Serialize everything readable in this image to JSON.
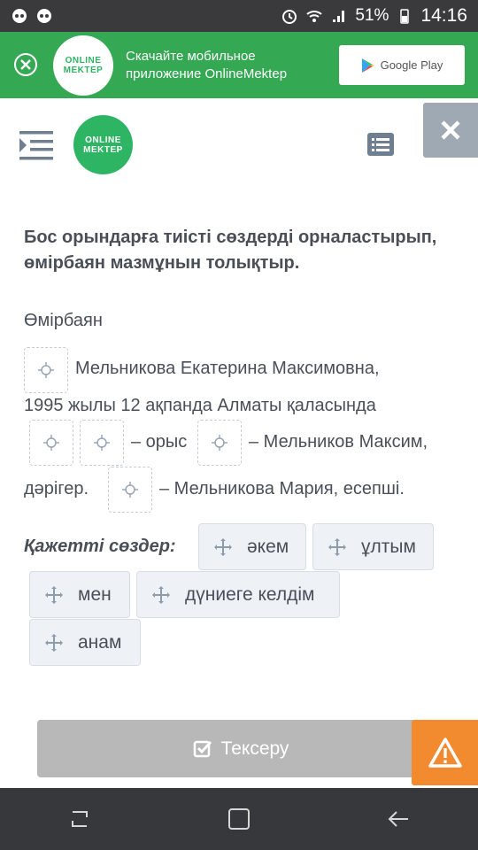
{
  "status_bar": {
    "battery": "51%",
    "time": "14:16"
  },
  "banner": {
    "logo_text_line1": "ONLINE",
    "logo_text_line2": "MEKTEP",
    "line1": "Скачайте мобильное",
    "line2": "приложение OnlineMektep",
    "store_button": "Google Play"
  },
  "header": {
    "logo_line1": "ONLINE",
    "logo_line2": "MEKTEP"
  },
  "task": {
    "question": "Бос орындарға тиісті сөздерді орналастырып, өмірбаян мазмұнын толықтыр.",
    "subtitle": "Өмірбаян",
    "text_1": "Мельникова Екатерина Максимовна,",
    "text_2": "1995 жылы 12 ақпанда Алматы қаласында",
    "text_3": "– орыс",
    "text_4": "– Мельников Максим,",
    "text_5": "дәрігер.",
    "text_6": "– Мельникова Мария, есепші."
  },
  "words": {
    "label": "Қажетті сөздер:",
    "items": [
      "әкем",
      "ұлтым",
      "мен",
      "дүниеге келдім",
      "анам"
    ]
  },
  "footer": {
    "check_button": "Тексеру"
  },
  "colors": {
    "brand_green": "#34a853",
    "logo_green": "#2eb563",
    "accent_orange": "#f28b30",
    "muted_gray": "#9fa9b4"
  }
}
